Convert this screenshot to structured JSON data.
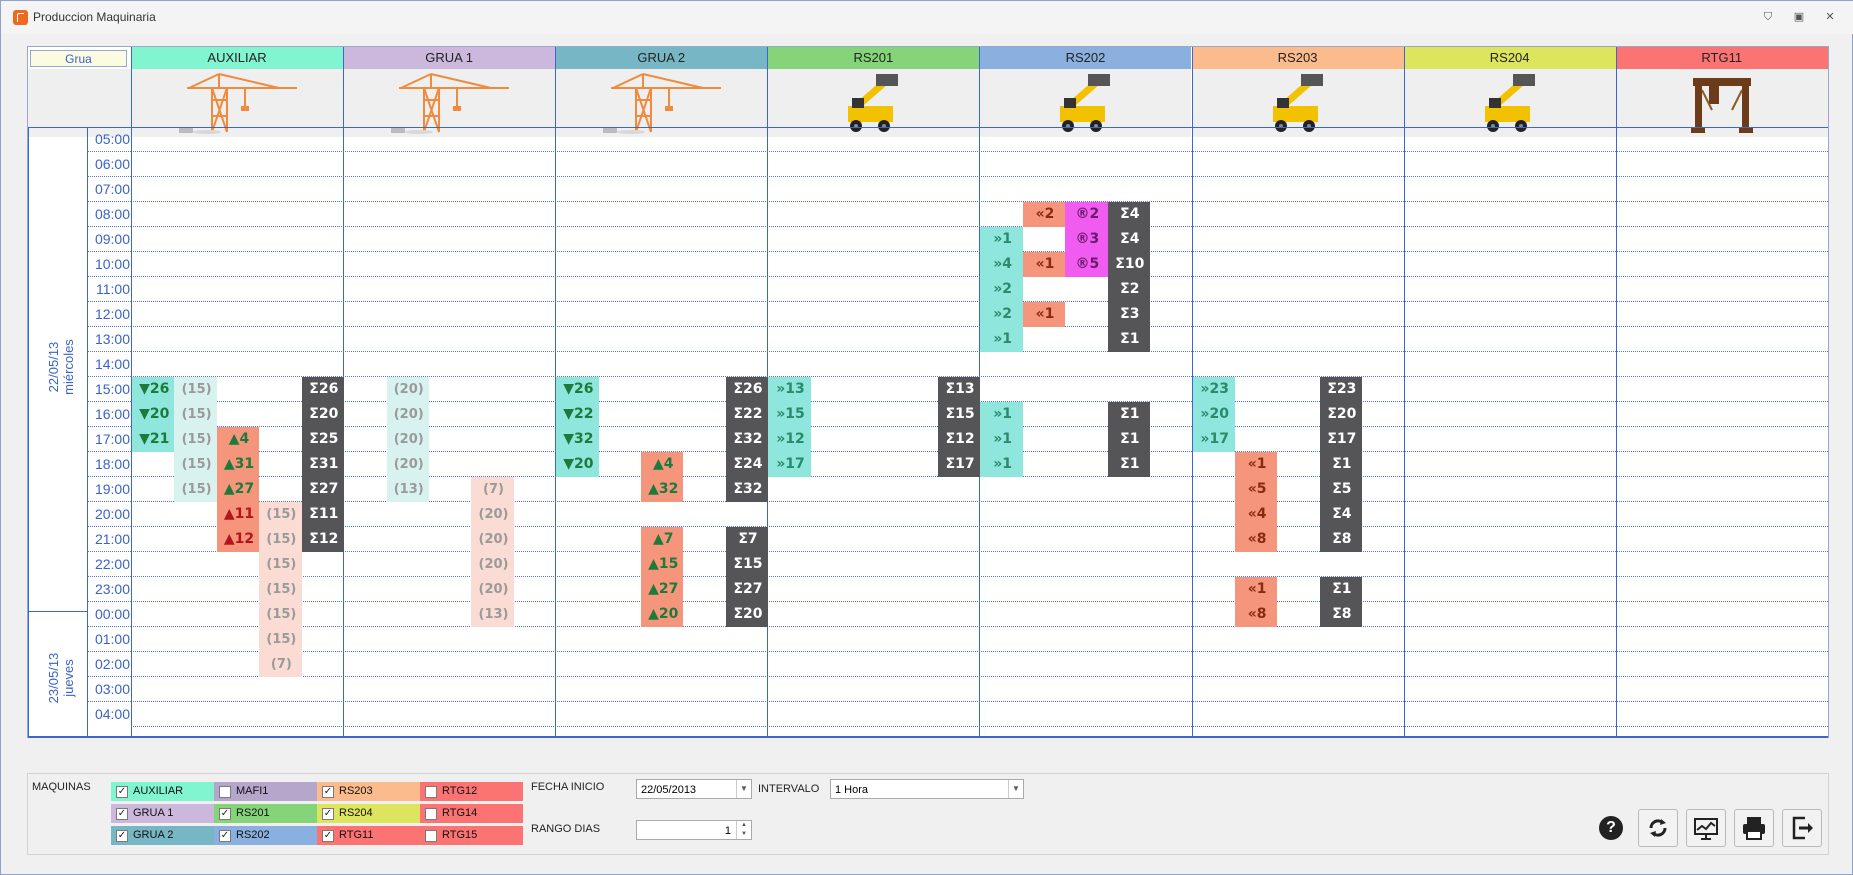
{
  "window": {
    "title": "Produccion Maquinaria",
    "buttons": [
      "⛉",
      "▣",
      "✕"
    ]
  },
  "grid": {
    "corner_label": "Grua",
    "day_labels": [
      {
        "date": "22/05/13",
        "weekday": "miércoles"
      },
      {
        "date": "23/05/13",
        "weekday": "jueves"
      }
    ],
    "times": [
      "05:00",
      "06:00",
      "07:00",
      "08:00",
      "09:00",
      "10:00",
      "11:00",
      "12:00",
      "13:00",
      "14:00",
      "15:00",
      "16:00",
      "17:00",
      "18:00",
      "19:00",
      "20:00",
      "21:00",
      "22:00",
      "23:00",
      "00:00",
      "01:00",
      "02:00",
      "03:00",
      "04:00"
    ],
    "machines": [
      {
        "name": "AUXILIAR",
        "color": "#80f5cf",
        "icon": "crane-icon"
      },
      {
        "name": "GRUA   1",
        "color": "#ccb8dc",
        "icon": "crane-icon"
      },
      {
        "name": "GRUA   2",
        "color": "#77b6c4",
        "icon": "crane-icon"
      },
      {
        "name": "RS201",
        "color": "#85d47a",
        "icon": "reach-stacker-icon"
      },
      {
        "name": "RS202",
        "color": "#8ab0e0",
        "icon": "reach-stacker-icon"
      },
      {
        "name": "RS203",
        "color": "#fbbb8c",
        "icon": "reach-stacker-icon"
      },
      {
        "name": "RS204",
        "color": "#dde45e",
        "icon": "reach-stacker-icon"
      },
      {
        "name": "RTG11",
        "color": "#fb7373",
        "icon": "rtg-crane-icon"
      }
    ],
    "cells": [
      {
        "m": 0,
        "s": 0,
        "r": 10,
        "t": "▼26",
        "k": "dn"
      },
      {
        "m": 0,
        "s": 1,
        "r": 10,
        "t": "(15)",
        "k": "pt"
      },
      {
        "m": 0,
        "s": 4,
        "r": 10,
        "t": "Σ26",
        "k": "sum"
      },
      {
        "m": 0,
        "s": 0,
        "r": 11,
        "t": "▼20",
        "k": "dn"
      },
      {
        "m": 0,
        "s": 1,
        "r": 11,
        "t": "(15)",
        "k": "pt"
      },
      {
        "m": 0,
        "s": 4,
        "r": 11,
        "t": "Σ20",
        "k": "sum"
      },
      {
        "m": 0,
        "s": 0,
        "r": 12,
        "t": "▼21",
        "k": "dn"
      },
      {
        "m": 0,
        "s": 1,
        "r": 12,
        "t": "(15)",
        "k": "pt"
      },
      {
        "m": 0,
        "s": 2,
        "r": 12,
        "t": "▲4",
        "k": "up"
      },
      {
        "m": 0,
        "s": 4,
        "r": 12,
        "t": "Σ25",
        "k": "sum"
      },
      {
        "m": 0,
        "s": 1,
        "r": 13,
        "t": "(15)",
        "k": "pt"
      },
      {
        "m": 0,
        "s": 2,
        "r": 13,
        "t": "▲31",
        "k": "up"
      },
      {
        "m": 0,
        "s": 4,
        "r": 13,
        "t": "Σ31",
        "k": "sum"
      },
      {
        "m": 0,
        "s": 1,
        "r": 14,
        "t": "(15)",
        "k": "pt"
      },
      {
        "m": 0,
        "s": 2,
        "r": 14,
        "t": "▲27",
        "k": "up"
      },
      {
        "m": 0,
        "s": 4,
        "r": 14,
        "t": "Σ27",
        "k": "sum"
      },
      {
        "m": 0,
        "s": 2,
        "r": 15,
        "t": "▲11",
        "k": "upr"
      },
      {
        "m": 0,
        "s": 3,
        "r": 15,
        "t": "(15)",
        "k": "pp"
      },
      {
        "m": 0,
        "s": 4,
        "r": 15,
        "t": "Σ11",
        "k": "sum"
      },
      {
        "m": 0,
        "s": 2,
        "r": 16,
        "t": "▲12",
        "k": "upr"
      },
      {
        "m": 0,
        "s": 3,
        "r": 16,
        "t": "(15)",
        "k": "pp"
      },
      {
        "m": 0,
        "s": 4,
        "r": 16,
        "t": "Σ12",
        "k": "sum"
      },
      {
        "m": 0,
        "s": 3,
        "r": 17,
        "t": "(15)",
        "k": "pp"
      },
      {
        "m": 0,
        "s": 3,
        "r": 18,
        "t": "(15)",
        "k": "pp"
      },
      {
        "m": 0,
        "s": 3,
        "r": 19,
        "t": "(15)",
        "k": "pp"
      },
      {
        "m": 0,
        "s": 3,
        "r": 20,
        "t": "(15)",
        "k": "pp"
      },
      {
        "m": 0,
        "s": 3,
        "r": 21,
        "t": "(7)",
        "k": "pp"
      },
      {
        "m": 1,
        "s": 1,
        "r": 10,
        "t": "(20)",
        "k": "pt"
      },
      {
        "m": 1,
        "s": 1,
        "r": 11,
        "t": "(20)",
        "k": "pt"
      },
      {
        "m": 1,
        "s": 1,
        "r": 12,
        "t": "(20)",
        "k": "pt"
      },
      {
        "m": 1,
        "s": 1,
        "r": 13,
        "t": "(20)",
        "k": "pt"
      },
      {
        "m": 1,
        "s": 1,
        "r": 14,
        "t": "(13)",
        "k": "pt"
      },
      {
        "m": 1,
        "s": 3,
        "r": 14,
        "t": "(7)",
        "k": "pp"
      },
      {
        "m": 1,
        "s": 3,
        "r": 15,
        "t": "(20)",
        "k": "pp"
      },
      {
        "m": 1,
        "s": 3,
        "r": 16,
        "t": "(20)",
        "k": "pp"
      },
      {
        "m": 1,
        "s": 3,
        "r": 17,
        "t": "(20)",
        "k": "pp"
      },
      {
        "m": 1,
        "s": 3,
        "r": 18,
        "t": "(20)",
        "k": "pp"
      },
      {
        "m": 1,
        "s": 3,
        "r": 19,
        "t": "(13)",
        "k": "pp"
      },
      {
        "m": 2,
        "s": 0,
        "r": 10,
        "t": "▼26",
        "k": "dn"
      },
      {
        "m": 2,
        "s": 4,
        "r": 10,
        "t": "Σ26",
        "k": "sum"
      },
      {
        "m": 2,
        "s": 0,
        "r": 11,
        "t": "▼22",
        "k": "dn"
      },
      {
        "m": 2,
        "s": 4,
        "r": 11,
        "t": "Σ22",
        "k": "sum"
      },
      {
        "m": 2,
        "s": 0,
        "r": 12,
        "t": "▼32",
        "k": "dn"
      },
      {
        "m": 2,
        "s": 4,
        "r": 12,
        "t": "Σ32",
        "k": "sum"
      },
      {
        "m": 2,
        "s": 0,
        "r": 13,
        "t": "▼20",
        "k": "dn"
      },
      {
        "m": 2,
        "s": 2,
        "r": 13,
        "t": "▲4",
        "k": "up"
      },
      {
        "m": 2,
        "s": 4,
        "r": 13,
        "t": "Σ24",
        "k": "sum"
      },
      {
        "m": 2,
        "s": 2,
        "r": 14,
        "t": "▲32",
        "k": "up"
      },
      {
        "m": 2,
        "s": 4,
        "r": 14,
        "t": "Σ32",
        "k": "sum"
      },
      {
        "m": 2,
        "s": 2,
        "r": 16,
        "t": "▲7",
        "k": "up"
      },
      {
        "m": 2,
        "s": 4,
        "r": 16,
        "t": "Σ7",
        "k": "sum"
      },
      {
        "m": 2,
        "s": 2,
        "r": 17,
        "t": "▲15",
        "k": "up"
      },
      {
        "m": 2,
        "s": 4,
        "r": 17,
        "t": "Σ15",
        "k": "sum"
      },
      {
        "m": 2,
        "s": 2,
        "r": 18,
        "t": "▲27",
        "k": "up"
      },
      {
        "m": 2,
        "s": 4,
        "r": 18,
        "t": "Σ27",
        "k": "sum"
      },
      {
        "m": 2,
        "s": 2,
        "r": 19,
        "t": "▲20",
        "k": "up"
      },
      {
        "m": 2,
        "s": 4,
        "r": 19,
        "t": "Σ20",
        "k": "sum"
      },
      {
        "m": 3,
        "s": 0,
        "r": 10,
        "t": "»13",
        "k": "in"
      },
      {
        "m": 3,
        "s": 4,
        "r": 10,
        "t": "Σ13",
        "k": "sum"
      },
      {
        "m": 3,
        "s": 0,
        "r": 11,
        "t": "»15",
        "k": "in"
      },
      {
        "m": 3,
        "s": 4,
        "r": 11,
        "t": "Σ15",
        "k": "sum"
      },
      {
        "m": 3,
        "s": 0,
        "r": 12,
        "t": "»12",
        "k": "in"
      },
      {
        "m": 3,
        "s": 4,
        "r": 12,
        "t": "Σ12",
        "k": "sum"
      },
      {
        "m": 3,
        "s": 0,
        "r": 13,
        "t": "»17",
        "k": "in"
      },
      {
        "m": 3,
        "s": 4,
        "r": 13,
        "t": "Σ17",
        "k": "sum"
      },
      {
        "m": 4,
        "s": 1,
        "r": 3,
        "t": "«2",
        "k": "out"
      },
      {
        "m": 4,
        "s": 2,
        "r": 3,
        "t": "®2",
        "k": "rs"
      },
      {
        "m": 4,
        "s": 3,
        "r": 3,
        "t": "Σ4",
        "k": "sum"
      },
      {
        "m": 4,
        "s": 0,
        "r": 4,
        "t": "»1",
        "k": "in"
      },
      {
        "m": 4,
        "s": 2,
        "r": 4,
        "t": "®3",
        "k": "rs"
      },
      {
        "m": 4,
        "s": 3,
        "r": 4,
        "t": "Σ4",
        "k": "sum"
      },
      {
        "m": 4,
        "s": 0,
        "r": 5,
        "t": "»4",
        "k": "in"
      },
      {
        "m": 4,
        "s": 1,
        "r": 5,
        "t": "«1",
        "k": "out"
      },
      {
        "m": 4,
        "s": 2,
        "r": 5,
        "t": "®5",
        "k": "rs"
      },
      {
        "m": 4,
        "s": 3,
        "r": 5,
        "t": "Σ10",
        "k": "sum"
      },
      {
        "m": 4,
        "s": 0,
        "r": 6,
        "t": "»2",
        "k": "in"
      },
      {
        "m": 4,
        "s": 3,
        "r": 6,
        "t": "Σ2",
        "k": "sum"
      },
      {
        "m": 4,
        "s": 0,
        "r": 7,
        "t": "»2",
        "k": "in"
      },
      {
        "m": 4,
        "s": 1,
        "r": 7,
        "t": "«1",
        "k": "out"
      },
      {
        "m": 4,
        "s": 3,
        "r": 7,
        "t": "Σ3",
        "k": "sum"
      },
      {
        "m": 4,
        "s": 0,
        "r": 8,
        "t": "»1",
        "k": "in"
      },
      {
        "m": 4,
        "s": 3,
        "r": 8,
        "t": "Σ1",
        "k": "sum"
      },
      {
        "m": 4,
        "s": 0,
        "r": 11,
        "t": "»1",
        "k": "in"
      },
      {
        "m": 4,
        "s": 3,
        "r": 11,
        "t": "Σ1",
        "k": "sum"
      },
      {
        "m": 4,
        "s": 0,
        "r": 12,
        "t": "»1",
        "k": "in"
      },
      {
        "m": 4,
        "s": 3,
        "r": 12,
        "t": "Σ1",
        "k": "sum"
      },
      {
        "m": 4,
        "s": 0,
        "r": 13,
        "t": "»1",
        "k": "in"
      },
      {
        "m": 4,
        "s": 3,
        "r": 13,
        "t": "Σ1",
        "k": "sum"
      },
      {
        "m": 5,
        "s": 0,
        "r": 10,
        "t": "»23",
        "k": "in"
      },
      {
        "m": 5,
        "s": 3,
        "r": 10,
        "t": "Σ23",
        "k": "sum"
      },
      {
        "m": 5,
        "s": 0,
        "r": 11,
        "t": "»20",
        "k": "in"
      },
      {
        "m": 5,
        "s": 3,
        "r": 11,
        "t": "Σ20",
        "k": "sum"
      },
      {
        "m": 5,
        "s": 0,
        "r": 12,
        "t": "»17",
        "k": "in"
      },
      {
        "m": 5,
        "s": 3,
        "r": 12,
        "t": "Σ17",
        "k": "sum"
      },
      {
        "m": 5,
        "s": 1,
        "r": 13,
        "t": "«1",
        "k": "out"
      },
      {
        "m": 5,
        "s": 3,
        "r": 13,
        "t": "Σ1",
        "k": "sum"
      },
      {
        "m": 5,
        "s": 1,
        "r": 14,
        "t": "«5",
        "k": "out"
      },
      {
        "m": 5,
        "s": 3,
        "r": 14,
        "t": "Σ5",
        "k": "sum"
      },
      {
        "m": 5,
        "s": 1,
        "r": 15,
        "t": "«4",
        "k": "out"
      },
      {
        "m": 5,
        "s": 3,
        "r": 15,
        "t": "Σ4",
        "k": "sum"
      },
      {
        "m": 5,
        "s": 1,
        "r": 16,
        "t": "«8",
        "k": "out"
      },
      {
        "m": 5,
        "s": 3,
        "r": 16,
        "t": "Σ8",
        "k": "sum"
      },
      {
        "m": 5,
        "s": 1,
        "r": 18,
        "t": "«1",
        "k": "out"
      },
      {
        "m": 5,
        "s": 3,
        "r": 18,
        "t": "Σ1",
        "k": "sum"
      },
      {
        "m": 5,
        "s": 1,
        "r": 19,
        "t": "«8",
        "k": "out"
      },
      {
        "m": 5,
        "s": 3,
        "r": 19,
        "t": "Σ8",
        "k": "sum"
      }
    ],
    "cell_styles": {
      "dn": {
        "bg": "#8ee6dc",
        "fg": "#1e7a3a"
      },
      "up": {
        "bg": "#f5957c",
        "fg": "#1e7a3a"
      },
      "upr": {
        "bg": "#f5957c",
        "fg": "#b4141e"
      },
      "pt": {
        "bg": "#d8f2f0",
        "fg": "#9a9a9a"
      },
      "pp": {
        "bg": "#fbdcd4",
        "fg": "#9a9a9a"
      },
      "sum": {
        "bg": "#555557",
        "fg": "#ffffff"
      },
      "in": {
        "bg": "#8ee6dc",
        "fg": "#2a8a6a"
      },
      "out": {
        "bg": "#f5957c",
        "fg": "#8a2a10"
      },
      "rs": {
        "bg": "#f05cf0",
        "fg": "#6b1a6b"
      }
    }
  },
  "controls": {
    "maquinas_label": "MAQUINAS",
    "checkboxes": [
      {
        "label": "AUXILIAR",
        "checked": true,
        "color": "#80f5cf"
      },
      {
        "label": "GRUA   1",
        "checked": true,
        "color": "#ccb8dc"
      },
      {
        "label": "GRUA   2",
        "checked": true,
        "color": "#77b6c4"
      },
      {
        "label": "MAFI1",
        "checked": false,
        "color": "#b5a6cc"
      },
      {
        "label": "RS201",
        "checked": true,
        "color": "#85d47a"
      },
      {
        "label": "RS202",
        "checked": true,
        "color": "#8ab0e0"
      },
      {
        "label": "RS203",
        "checked": true,
        "color": "#fbbb8c"
      },
      {
        "label": "RS204",
        "checked": true,
        "color": "#dde45e"
      },
      {
        "label": "RTG11",
        "checked": true,
        "color": "#fb7373"
      },
      {
        "label": "RTG12",
        "checked": false,
        "color": "#fb7373"
      },
      {
        "label": "RTG14",
        "checked": false,
        "color": "#fb7373"
      },
      {
        "label": "RTG15",
        "checked": false,
        "color": "#fb7373"
      }
    ],
    "fecha_inicio_label": "FECHA INICIO",
    "fecha_inicio_value": "22/05/2013",
    "intervalo_label": "INTERVALO",
    "intervalo_value": "1 Hora",
    "rango_dias_label": "RANGO DIAS",
    "rango_dias_value": "1",
    "toolbar": [
      {
        "name": "refresh-button",
        "icon": "refresh-icon"
      },
      {
        "name": "chart-button",
        "icon": "chart-icon"
      },
      {
        "name": "print-button",
        "icon": "printer-icon"
      },
      {
        "name": "exit-button",
        "icon": "exit-icon"
      }
    ]
  }
}
